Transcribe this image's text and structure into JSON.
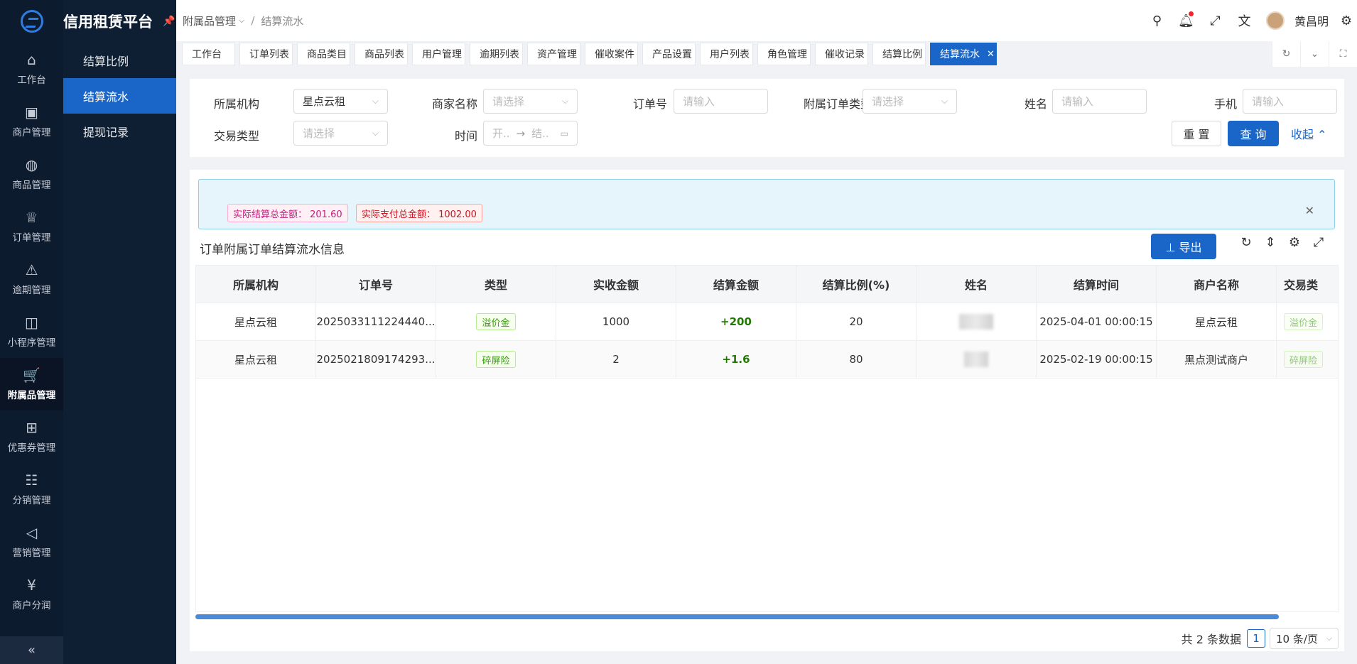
{
  "app": {
    "title": "信用租赁平台"
  },
  "rail": {
    "items": [
      {
        "label": "工作台",
        "icon": "home-icon",
        "glyph": "⌂"
      },
      {
        "label": "商户管理",
        "icon": "briefcase-icon",
        "glyph": "▣"
      },
      {
        "label": "商品管理",
        "icon": "apple-icon",
        "glyph": "◍"
      },
      {
        "label": "订单管理",
        "icon": "trophy-icon",
        "glyph": "♕"
      },
      {
        "label": "逾期管理",
        "icon": "alarm-icon",
        "glyph": "⚠"
      },
      {
        "label": "小程序管理",
        "icon": "android-icon",
        "glyph": "◫"
      },
      {
        "label": "附属品管理",
        "icon": "cart-icon",
        "glyph": "🛒"
      },
      {
        "label": "优惠券管理",
        "icon": "gift-icon",
        "glyph": "⊞"
      },
      {
        "label": "分销管理",
        "icon": "sliders-icon",
        "glyph": "☷"
      },
      {
        "label": "营销管理",
        "icon": "megaphone-icon",
        "glyph": "◁"
      },
      {
        "label": "商户分润",
        "icon": "yen-icon",
        "glyph": "¥"
      }
    ],
    "collapse_glyph": "«"
  },
  "sub": {
    "items": [
      {
        "label": "结算比例"
      },
      {
        "label": "结算流水"
      },
      {
        "label": "提现记录"
      }
    ]
  },
  "header": {
    "crumb_parent": "附属品管理",
    "crumb_sep": "/",
    "crumb_current": "结算流水",
    "user": "黄昌明"
  },
  "tabs": [
    "工作台",
    "订单列表",
    "商品类目",
    "商品列表",
    "用户管理",
    "逾期列表",
    "资产管理",
    "催收案件",
    "产品设置",
    "用户列表",
    "角色管理",
    "催收记录",
    "结算比例",
    "结算流水"
  ],
  "filter": {
    "org_label": "所属机构",
    "org_value": "星点云租",
    "merchant_label": "商家名称",
    "merchant_ph": "请选择",
    "order_label": "订单号",
    "order_ph": "请输入",
    "type_label": "附属订单类型",
    "type_ph": "请选择",
    "name_label": "姓名",
    "name_ph": "请输入",
    "phone_label": "手机",
    "phone_ph": "请输入",
    "trade_label": "交易类型",
    "trade_ph": "请选择",
    "time_label": "时间",
    "time_start_ph": "开..",
    "time_end_ph": "结..",
    "time_arrow": "→",
    "reset": "重 置",
    "query": "查 询",
    "collapse": "收起 ⌃"
  },
  "summary": {
    "settle_total": "实际结算总金额：  201.60",
    "pay_total": "实际支付总金额：  1002.00"
  },
  "table": {
    "title": "订单附属订单结算流水信息",
    "export": "⊥  导出",
    "columns": [
      "所属机构",
      "订单号",
      "类型",
      "实收金额",
      "结算金额",
      "结算比例(%)",
      "姓名",
      "结算时间",
      "商户名称",
      "交易类"
    ],
    "rows": [
      {
        "org": "星点云租",
        "order": "2025033111224440...",
        "type": "溢价金",
        "received": "1000",
        "settle": "+200",
        "ratio": "20",
        "time": "2025-04-01 00:00:15",
        "merchant": "星点云租",
        "trade": "溢价金"
      },
      {
        "org": "星点云租",
        "order": "2025021809174293...",
        "type": "碎屏险",
        "received": "2",
        "settle": "+1.6",
        "ratio": "80",
        "time": "2025-02-19 00:00:15",
        "merchant": "黑点测试商户",
        "trade": "碎屏险"
      }
    ]
  },
  "pager": {
    "total": "共 2 条数据",
    "current": "1",
    "size": "10 条/页"
  },
  "colors": {
    "primary": "#1a66c8",
    "rail_bg": "#0d1b2e"
  }
}
